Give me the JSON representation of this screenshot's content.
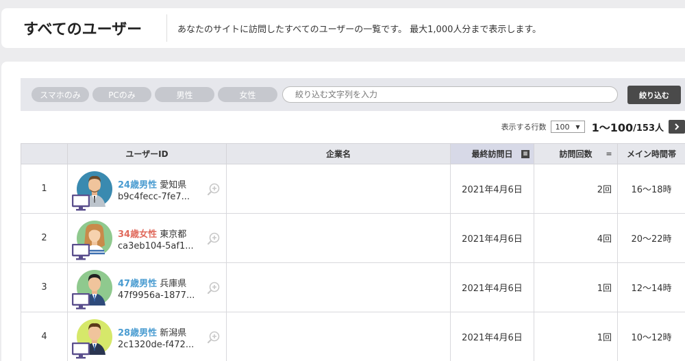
{
  "header": {
    "title": "すべてのユーザー",
    "description": "あなたのサイトに訪問したすべてのユーザーの一覧です。 最大1,000人分まで表示します。"
  },
  "filters": {
    "buttons": [
      "スマホのみ",
      "PCのみ",
      "男性",
      "女性"
    ],
    "search_placeholder": "絞り込む文字列を入力",
    "submit_label": "絞り込む"
  },
  "pager": {
    "rows_label": "表示する行数",
    "rows_value": "100",
    "range": "1〜100",
    "total": "/153人"
  },
  "table": {
    "headers": [
      "",
      "ユーザーID",
      "企業名",
      "最終訪問日",
      "訪問回数",
      "メイン時間帯"
    ],
    "rows": [
      {
        "no": "1",
        "age": "24歳男性",
        "gender": "male",
        "pref": "愛知県",
        "uid": "b9c4fecc-7fe7...",
        "company": "",
        "last_visit": "2021年4月6日",
        "visits": "2回",
        "time": "16〜18時"
      },
      {
        "no": "2",
        "age": "34歳女性",
        "gender": "female",
        "pref": "東京都",
        "uid": "ca3eb104-5af1...",
        "company": "",
        "last_visit": "2021年4月6日",
        "visits": "4回",
        "time": "20〜22時"
      },
      {
        "no": "3",
        "age": "47歳男性",
        "gender": "male",
        "pref": "兵庫県",
        "uid": "47f9956a-1877...",
        "company": "",
        "last_visit": "2021年4月6日",
        "visits": "1回",
        "time": "12〜14時"
      },
      {
        "no": "4",
        "age": "28歳男性",
        "gender": "male",
        "pref": "新潟県",
        "uid": "2c1320de-f472...",
        "company": "",
        "last_visit": "2021年4月6日",
        "visits": "1回",
        "time": "10〜12時"
      }
    ]
  },
  "icons": {
    "sort_active": "sort-desc-icon",
    "sort_inactive": "sort-icon",
    "device": "desktop-icon",
    "zoom": "zoom-in-icon",
    "next": "chevron-right-icon"
  },
  "colors": {
    "male": "#4a9cd1",
    "female": "#e06a5c",
    "button_dark": "#4a4a4a",
    "pill": "#c6c8ce",
    "device_icon": "#5a4e8c"
  }
}
